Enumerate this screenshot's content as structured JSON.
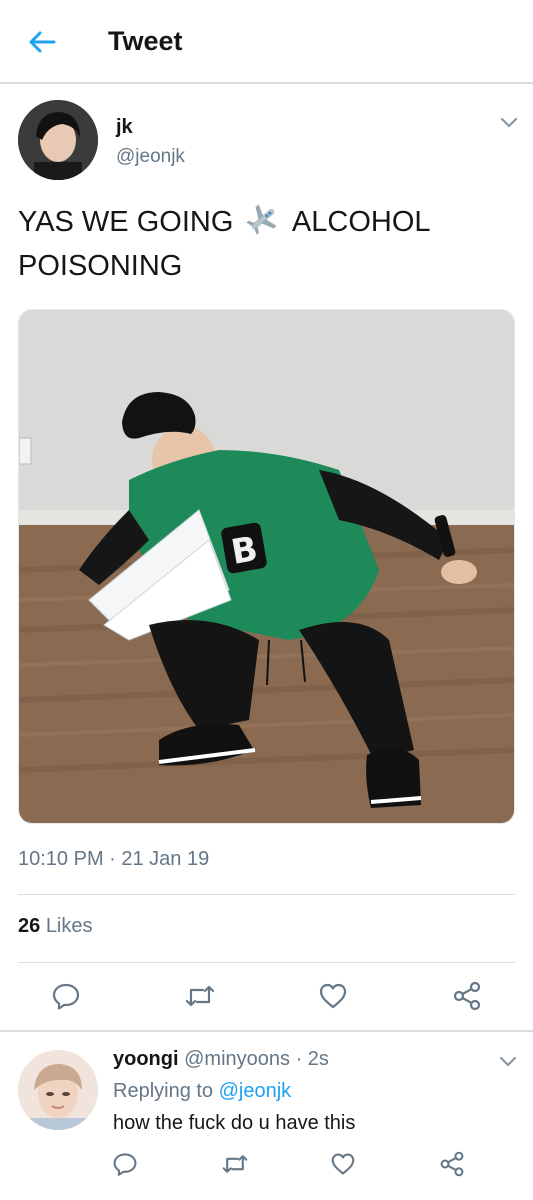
{
  "header": {
    "title": "Tweet",
    "back_icon": "arrow-left-icon"
  },
  "colors": {
    "accent": "#1da1f2",
    "muted": "#657786",
    "text": "#14171a",
    "divider": "#d9dde0"
  },
  "tweet": {
    "author_name": "jk",
    "author_handle": "@jeonjk",
    "text_before_emoji": "YAS WE GOING",
    "emoji": "airplane-emoji",
    "text_after_emoji": "ALCOHOL POISONING",
    "timestamp": "10:10 PM · 21 Jan 19",
    "likes_count": "26",
    "likes_label": "Likes",
    "actions": [
      "reply-icon",
      "retweet-icon",
      "like-icon",
      "share-icon"
    ]
  },
  "reply": {
    "author_name": "yoongi",
    "author_handle": "@minyoons",
    "time": "· 2s",
    "replying_prefix": "Replying to",
    "replying_to": "@jeonjk",
    "text": "how the fuck do u have this",
    "actions": [
      "reply-icon",
      "retweet-icon",
      "like-icon",
      "share-icon"
    ]
  }
}
